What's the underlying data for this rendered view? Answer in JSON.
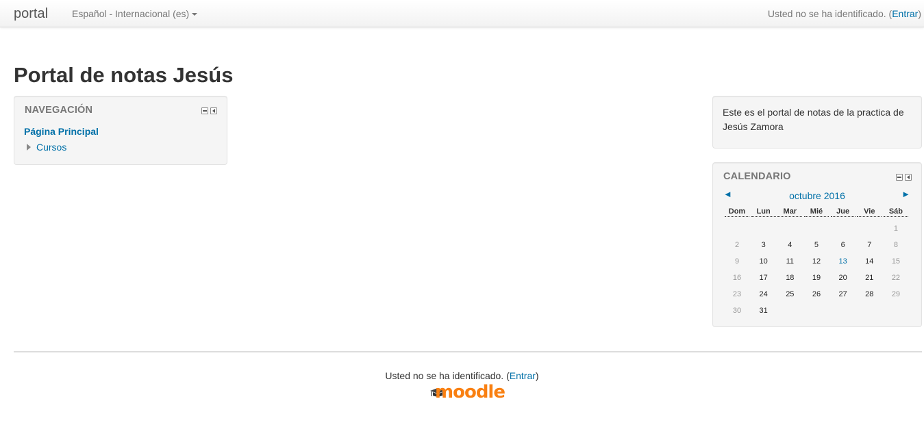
{
  "navbar": {
    "brand": "portal",
    "language": "Español - Internacional (es)",
    "login_text": "Usted no se ha identificado. (",
    "login_link": "Entrar",
    "login_close": ")"
  },
  "page": {
    "title": "Portal de notas Jesús"
  },
  "navigation_block": {
    "title": "NAVEGACIÓN",
    "home": "Página Principal",
    "items": [
      {
        "label": "Cursos"
      }
    ]
  },
  "html_block": {
    "text": "Este es el portal de notas de la practica de Jesús Zamora"
  },
  "calendar": {
    "title": "CALENDARIO",
    "prev_symbol": "◄",
    "next_symbol": "►",
    "month": "octubre 2016",
    "day_names": [
      "Dom",
      "Lun",
      "Mar",
      "Mié",
      "Jue",
      "Vie",
      "Sáb"
    ],
    "weeks": [
      [
        "",
        "",
        "",
        "",
        "",
        "",
        "1"
      ],
      [
        "2",
        "3",
        "4",
        "5",
        "6",
        "7",
        "8"
      ],
      [
        "9",
        "10",
        "11",
        "12",
        "13",
        "14",
        "15"
      ],
      [
        "16",
        "17",
        "18",
        "19",
        "20",
        "21",
        "22"
      ],
      [
        "23",
        "24",
        "25",
        "26",
        "27",
        "28",
        "29"
      ],
      [
        "30",
        "31",
        "",
        "",
        "",
        "",
        ""
      ]
    ],
    "today": "13"
  },
  "footer": {
    "login_text": "Usted no se ha identificado. (",
    "login_link": "Entrar",
    "login_close": ")",
    "logo_text": "moodle"
  },
  "colors": {
    "link": "#0070a8",
    "moodle_orange": "#f98012"
  }
}
